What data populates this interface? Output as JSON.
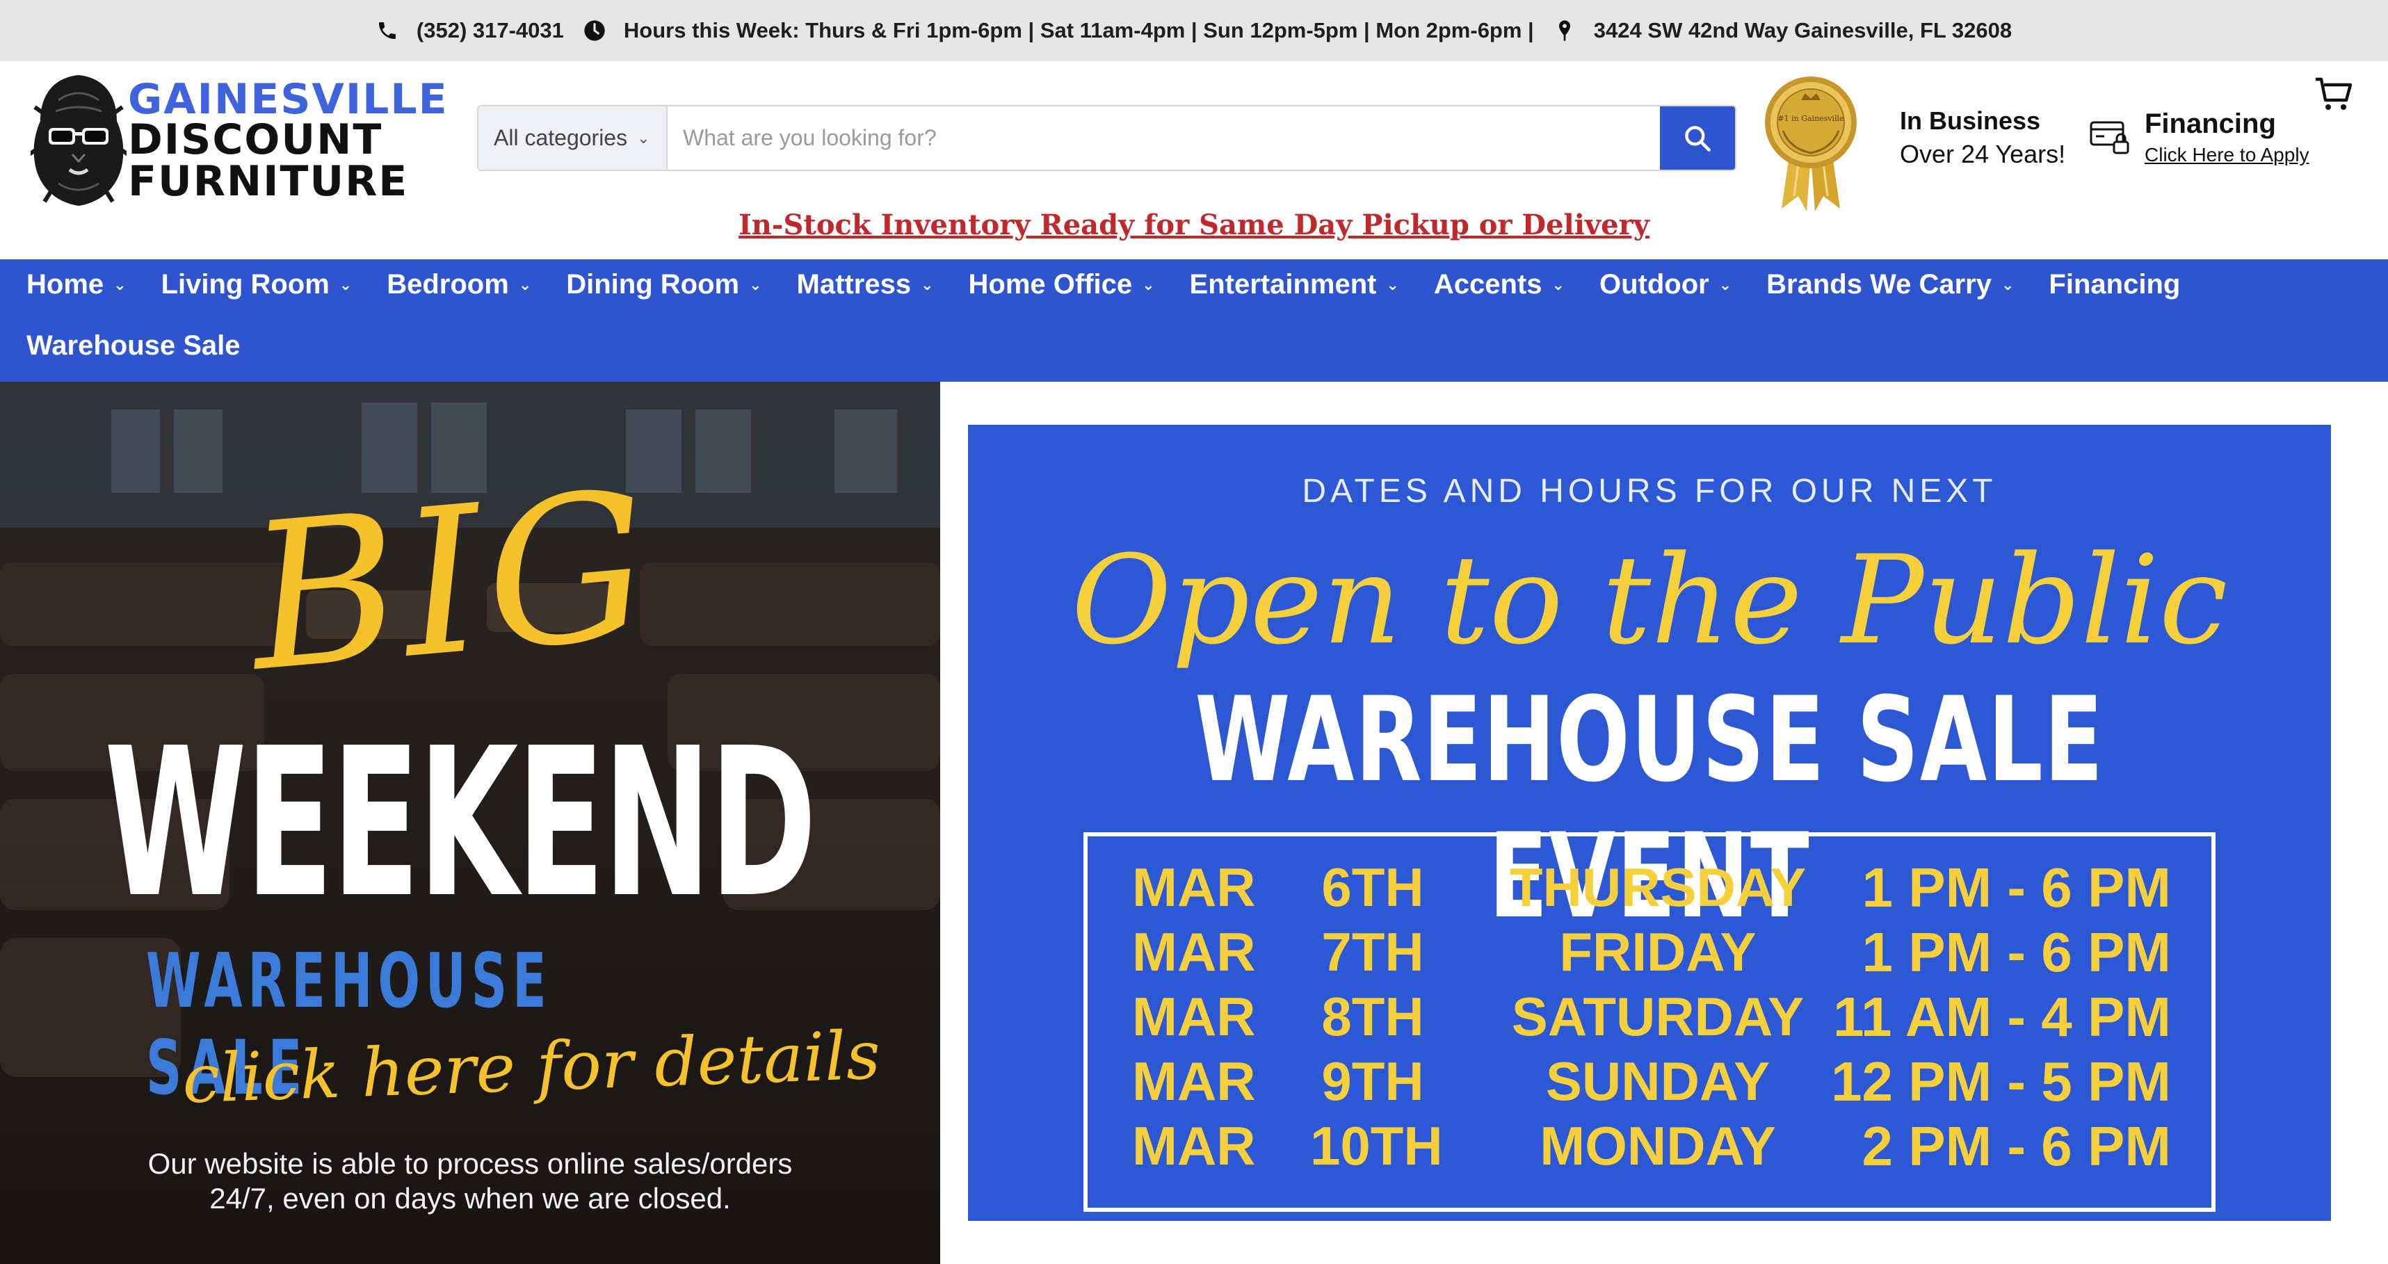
{
  "topbar": {
    "phone": "(352) 317-4031",
    "hours": "Hours this Week: Thurs & Fri 1pm-6pm | Sat 11am-4pm | Sun 12pm-5pm | Mon 2pm-6pm |",
    "address": "3424 SW 42nd Way Gainesville, FL 32608"
  },
  "logo": {
    "line1": "GAINESVILLE",
    "line2": "DISCOUNT",
    "line3": "FURNITURE"
  },
  "search": {
    "category": "All categories",
    "placeholder": "What are you looking for?"
  },
  "award": {
    "text": "#1 in Gainesville"
  },
  "in_business": {
    "line1": "In Business",
    "line2": "Over 24 Years!"
  },
  "financing": {
    "title": "Financing",
    "link": "Click Here to Apply"
  },
  "promo": "In-Stock Inventory Ready for Same Day Pickup or Delivery",
  "nav": {
    "items": [
      {
        "label": "Home"
      },
      {
        "label": "Living Room"
      },
      {
        "label": "Bedroom"
      },
      {
        "label": "Dining Room"
      },
      {
        "label": "Mattress"
      },
      {
        "label": "Home Office"
      },
      {
        "label": "Entertainment"
      },
      {
        "label": "Accents"
      },
      {
        "label": "Outdoor"
      },
      {
        "label": "Brands We Carry"
      },
      {
        "label": "Financing"
      },
      {
        "label": "Warehouse Sale"
      }
    ]
  },
  "banner_left": {
    "big": "BIG",
    "weekend": "WEEKEND",
    "warehouse_sale": "WAREHOUSE SALE",
    "click": "click here for details",
    "online_line1": "Our website is able to process online sales/orders",
    "online_line2": "24/7, even on days when we are closed."
  },
  "banner_right": {
    "pre": "DATES AND HOURS FOR OUR NEXT",
    "script": "Open to the Public",
    "event": "WAREHOUSE SALE EVENT",
    "schedule": [
      {
        "month": "MAR",
        "date": "6TH",
        "day": "THURSDAY",
        "hours": "1 PM - 6 PM"
      },
      {
        "month": "MAR",
        "date": "7TH",
        "day": "FRIDAY",
        "hours": "1 PM - 6 PM"
      },
      {
        "month": "MAR",
        "date": "8TH",
        "day": "SATURDAY",
        "hours": "11 AM - 4 PM"
      },
      {
        "month": "MAR",
        "date": "9TH",
        "day": "SUNDAY",
        "hours": "12 PM - 5 PM"
      },
      {
        "month": "MAR",
        "date": "10TH",
        "day": "MONDAY",
        "hours": "2 PM - 6 PM"
      }
    ]
  },
  "colors": {
    "brand_blue": "#2e55cf",
    "promo_red": "#c0282b",
    "accent_yellow": "#f5c22c"
  },
  "icons": [
    "phone-icon",
    "clock-icon",
    "pin-icon",
    "search-icon",
    "credit-card-icon",
    "cart-icon"
  ]
}
